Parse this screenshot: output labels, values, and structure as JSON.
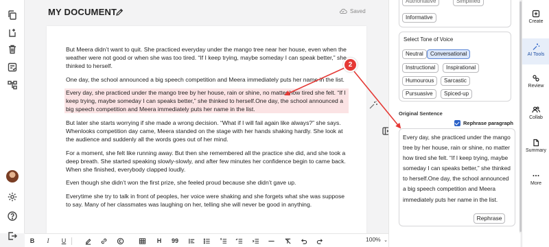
{
  "header": {
    "doc_title": "MY DOCUMENT",
    "saved_label": "Saved"
  },
  "document": {
    "paragraphs": [
      "But Meera didn’t want to quit. She practiced everyday under the mango tree near her house, even when the weather were not good or when she was too tired. “If I keep trying, maybe someday I can speak better,” she thinked to herself.",
      "One day, the school announced a big speech competition and Meera immediately puts her name in the list.",
      "Every day, she practiced under the mango tree by her house, rain or shine, no matter how tired she felt. “If I keep trying, maybe someday I can speaks better,” she thinked to herself.One day, the school announced a big speech competition and Meera immediately puts her name in the list.",
      "But later she starts worrying if she made a wrong decision. “What if I will fail again like always?” she says. Whenlooks competition day came, Meera standed on the stage with her hands shaking hardly. She look at the audience and suddenly all the words goes out of her mind.",
      "For a moment, she felt like running away. But then she remembered all the practice she did, and she took a deep breath. She started speaking slowly-slowly, and after few minutes her confidence begin to came back. When she finished, everybody clapped loudly.",
      "Even though she didn’t won the first prize, she feeled proud because she didn’t gave up.",
      "Everytime she try to talk in front of peoples, her voice were shaking and she forgets what she was suppose to say. Many of her classmates was laughing on her, telling she will never be good in anything."
    ],
    "highlighted_index": 2
  },
  "toolbar": {
    "heading_label": "H",
    "quote_label": "99",
    "zoom": "100%"
  },
  "panel": {
    "top_chips": [
      "Authoritative",
      "Simplified",
      "Informative"
    ],
    "tone_title": "Select Tone of Voice",
    "tone_chips": [
      "Neutral",
      "Conversational",
      "Instructional",
      "Inspirational",
      "Humourous",
      "Sarcastic",
      "Pursuasive",
      "Spiced-up"
    ],
    "selected_tone": "Conversational",
    "original_title": "Original Sentence",
    "rephrase_paragraph_label": "Rephrase paragraph",
    "rephrase_paragraph_checked": true,
    "original_text": "Every day, she practiced under the mango tree by her house, rain or shine, no matter how tired she felt. “If I keep trying, maybe someday I can speaks better,” she thinked to herself.One day, the school announced a big speech competition and Meera immediately puts her name in the list.",
    "rephrase_button": "Rephrase"
  },
  "right_rail": {
    "items": [
      {
        "label": "Create",
        "icon": "plus-square-icon"
      },
      {
        "label": "AI Tools",
        "icon": "magic-wand-icon",
        "active": true
      },
      {
        "label": "Review",
        "icon": "review-icon"
      },
      {
        "label": "Collab",
        "icon": "users-icon"
      },
      {
        "label": "Summary",
        "icon": "document-icon"
      },
      {
        "label": "More",
        "icon": "more-dots-icon"
      }
    ]
  },
  "annotation": {
    "badge_number": "2",
    "color": "#e53935"
  },
  "colors": {
    "highlight": "#fbe3e4",
    "accent": "#2d63c8",
    "selected_chip": "#dbe7fb"
  }
}
